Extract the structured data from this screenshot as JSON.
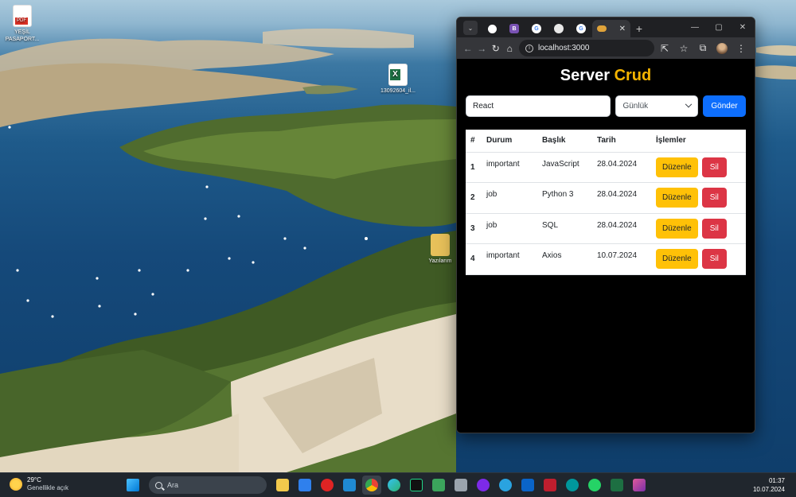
{
  "desktop": {
    "icons": [
      {
        "label": "YEŞİL PASAPORT...",
        "kind": "pdf-icon"
      },
      {
        "label": "13092604_il...",
        "kind": "excel-icon"
      },
      {
        "label": "Yazılarım",
        "kind": "folder-icon"
      }
    ]
  },
  "browser": {
    "tabs": [
      {
        "icon": "github-icon"
      },
      {
        "icon": "bootstrap-icon",
        "glyph": "B"
      },
      {
        "icon": "google-icon",
        "glyph": "G"
      },
      {
        "icon": "chatgpt-icon"
      },
      {
        "icon": "google-icon",
        "glyph": "G"
      },
      {
        "icon": "react-app-icon",
        "active": true
      }
    ],
    "url": "localhost:3000"
  },
  "app": {
    "title_main": "Server",
    "title_accent": "Crud",
    "title_accent_color": "#f5b400",
    "form": {
      "title_input_value": "React",
      "status_select_value": "Günlük",
      "submit_label": "Gönder"
    },
    "table": {
      "headers": [
        "#",
        "Durum",
        "Başlık",
        "Tarih",
        "İşlemler"
      ],
      "rows": [
        {
          "id": "1",
          "status": "important",
          "title": "JavaScript",
          "date": "28.04.2024"
        },
        {
          "id": "2",
          "status": "job",
          "title": "Python 3",
          "date": "28.04.2024"
        },
        {
          "id": "3",
          "status": "job",
          "title": "SQL",
          "date": "28.04.2024"
        },
        {
          "id": "4",
          "status": "important",
          "title": "Axios",
          "date": "10.07.2024"
        }
      ],
      "edit_label": "Düzenle",
      "delete_label": "Sil"
    }
  },
  "taskbar": {
    "weather_temp": "29°C",
    "weather_text": "Genellikle açık",
    "search_placeholder": "Ara",
    "time": "01:37",
    "date": "10.07.2024"
  }
}
